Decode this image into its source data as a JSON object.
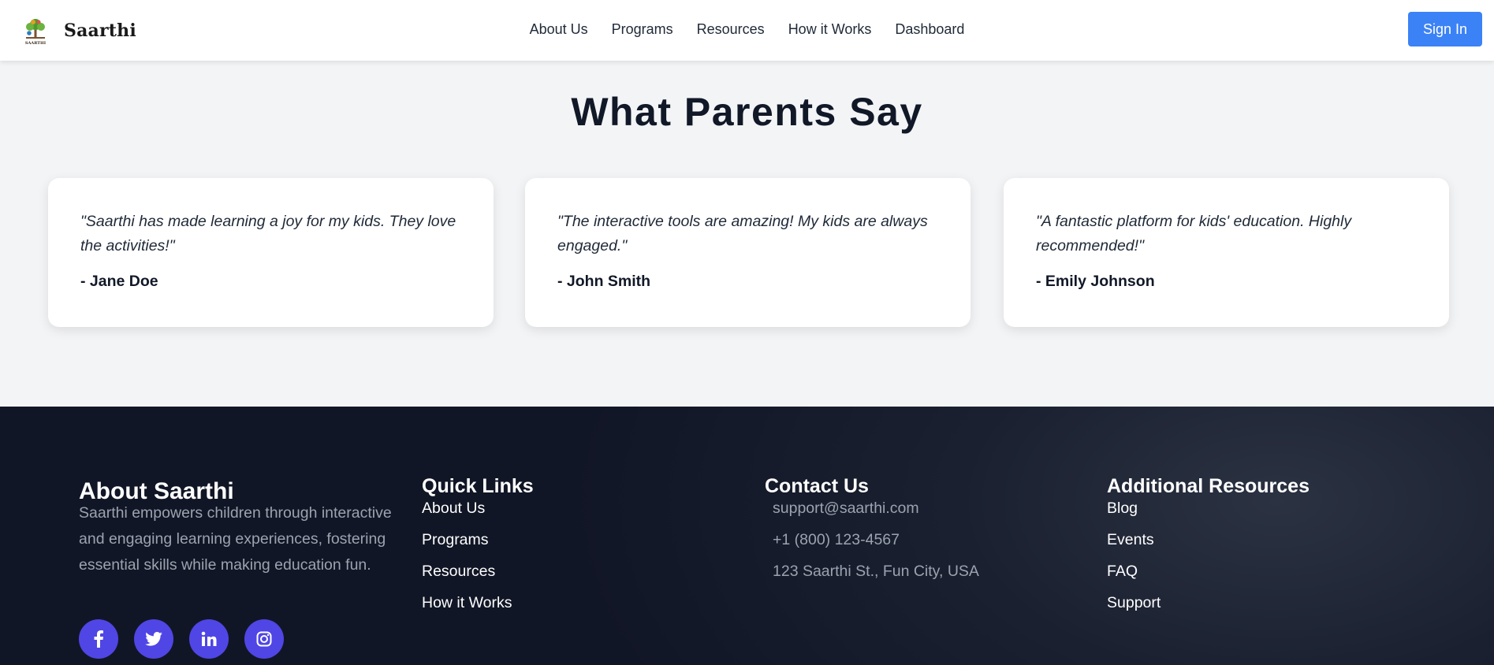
{
  "header": {
    "brand_name": "Saarthi",
    "logo_caption": "SAARTHI",
    "nav": [
      "About Us",
      "Programs",
      "Resources",
      "How it Works",
      "Dashboard"
    ],
    "signin_label": "Sign In"
  },
  "testimonials": {
    "title": "What Parents Say",
    "items": [
      {
        "quote": "\"Saarthi has made learning a joy for my kids. They love the activities!\"",
        "author": "- Jane Doe"
      },
      {
        "quote": "\"The interactive tools are amazing! My kids are always engaged.\"",
        "author": "- John Smith"
      },
      {
        "quote": "\"A fantastic platform for kids' education. Highly recommended!\"",
        "author": "- Emily Johnson"
      }
    ]
  },
  "footer": {
    "about": {
      "title": "About Saarthi",
      "text": "Saarthi empowers children through interactive and engaging learning experiences, fostering essential skills while making education fun."
    },
    "quick_links": {
      "title": "Quick Links",
      "items": [
        "About Us",
        "Programs",
        "Resources",
        "How it Works"
      ]
    },
    "contact": {
      "title": "Contact Us",
      "items": [
        "support@saarthi.com",
        "+1 (800) 123-4567",
        "123 Saarthi St., Fun City, USA"
      ]
    },
    "resources": {
      "title": "Additional Resources",
      "items": [
        "Blog",
        "Events",
        "FAQ",
        "Support"
      ]
    },
    "socials": [
      "facebook-icon",
      "twitter-icon",
      "linkedin-icon",
      "instagram-icon"
    ]
  },
  "colors": {
    "accent": "#3b82f6",
    "social": "#4f46e5",
    "footer_bg": "#111827",
    "page_bg": "#f3f4f6"
  }
}
